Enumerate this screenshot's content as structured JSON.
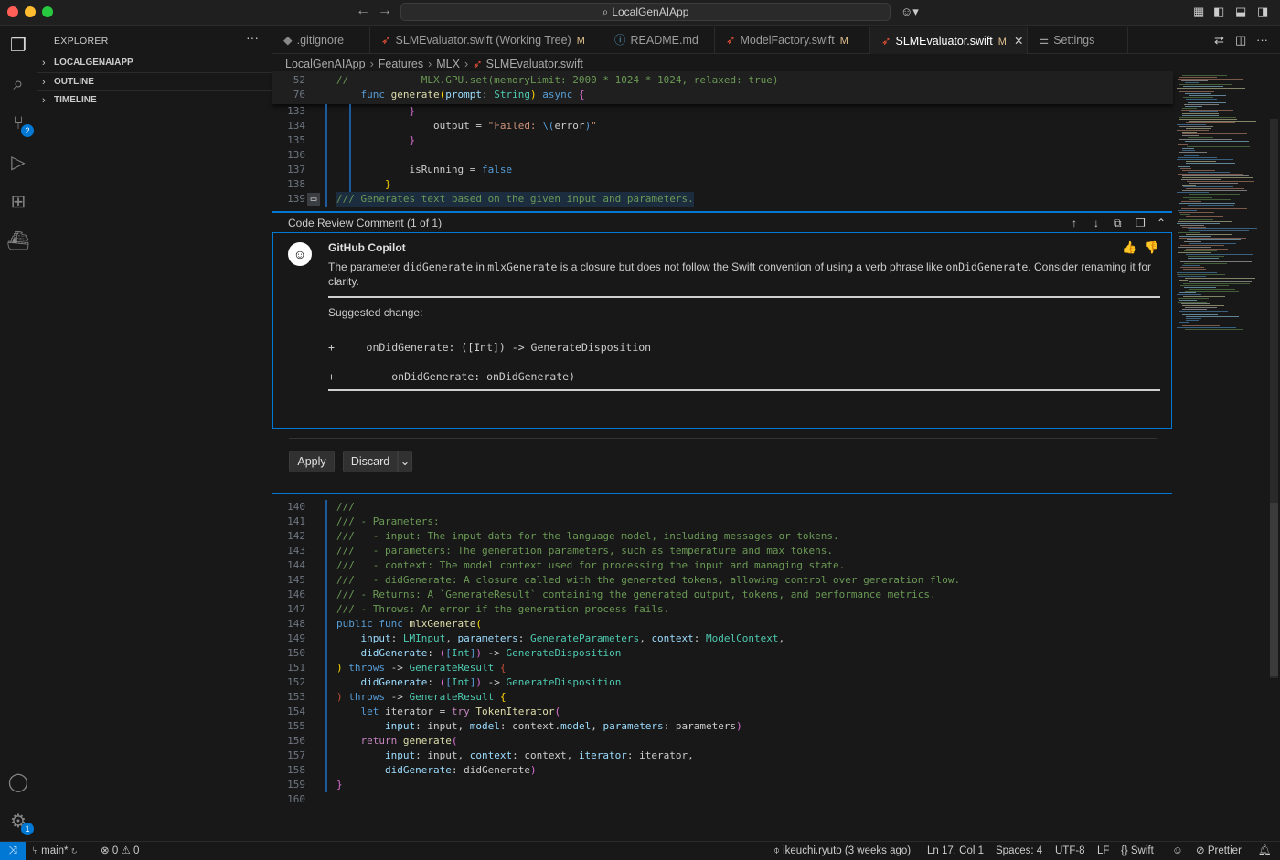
{
  "window": {
    "title": "LocalGenAIApp"
  },
  "activity": {
    "scm_badge": "2",
    "settings_badge": "1"
  },
  "sidebar": {
    "title": "EXPLORER",
    "sections": [
      "LOCALGENAIAPP",
      "OUTLINE",
      "TIMELINE"
    ]
  },
  "tabs": [
    {
      "label": ".gitignore",
      "modified": ""
    },
    {
      "label": "SLMEvaluator.swift (Working Tree)",
      "modified": "M"
    },
    {
      "label": "README.md",
      "modified": ""
    },
    {
      "label": "ModelFactory.swift",
      "modified": "M"
    },
    {
      "label": "SLMEvaluator.swift",
      "modified": "M"
    },
    {
      "label": "Settings",
      "modified": ""
    }
  ],
  "breadcrumb": [
    "LocalGenAIApp",
    "Features",
    "MLX",
    "SLMEvaluator.swift"
  ],
  "sticky": [
    {
      "num": "52",
      "code": "//            MLX.GPU.set(memoryLimit: 2000 * 1024 * 1024, relaxed: true)"
    },
    {
      "num": "76",
      "code": "    func generate(prompt: String) async {"
    }
  ],
  "code_top": [
    {
      "num": "133",
      "code": "            }"
    },
    {
      "num": "134",
      "code": "                output = \"Failed: \\(error)\""
    },
    {
      "num": "135",
      "code": "            }"
    },
    {
      "num": "136",
      "code": ""
    },
    {
      "num": "137",
      "code": "            isRunning = false"
    },
    {
      "num": "138",
      "code": "        }"
    },
    {
      "num": "139",
      "code": "/// Generates text based on the given input and parameters."
    }
  ],
  "review": {
    "header": "Code Review Comment (1 of 1)",
    "author": "GitHub Copilot",
    "comment_pre": "The parameter ",
    "comment_code1": "didGenerate",
    "comment_mid1": " in ",
    "comment_code2": "mlxGenerate",
    "comment_mid2": " is a closure but does not follow the Swift convention of using a verb phrase like ",
    "comment_code3": "onDidGenerate",
    "comment_post": ". Consider renaming it for clarity.",
    "suggested_label": "Suggested change:",
    "diff": [
      "+     onDidGenerate: ([Int]) -> GenerateDisposition",
      "+         onDidGenerate: onDidGenerate)"
    ],
    "apply": "Apply",
    "discard": "Discard"
  },
  "code_bottom": [
    {
      "num": "140",
      "code": "///"
    },
    {
      "num": "141",
      "code": "/// - Parameters:"
    },
    {
      "num": "142",
      "code": "///   - input: The input data for the language model, including messages or tokens."
    },
    {
      "num": "143",
      "code": "///   - parameters: The generation parameters, such as temperature and max tokens."
    },
    {
      "num": "144",
      "code": "///   - context: The model context used for processing the input and managing state."
    },
    {
      "num": "145",
      "code": "///   - didGenerate: A closure called with the generated tokens, allowing control over generation flow."
    },
    {
      "num": "146",
      "code": "/// - Returns: A `GenerateResult` containing the generated output, tokens, and performance metrics."
    },
    {
      "num": "147",
      "code": "/// - Throws: An error if the generation process fails."
    },
    {
      "num": "148",
      "code": "public func mlxGenerate("
    },
    {
      "num": "149",
      "code": "    input: LMInput, parameters: GenerateParameters, context: ModelContext,"
    },
    {
      "num": "150",
      "code": "    didGenerate: ([Int]) -> GenerateDisposition"
    },
    {
      "num": "151",
      "code": ") throws -> GenerateResult {"
    },
    {
      "num": "152",
      "code": "    didGenerate: ([Int]) -> GenerateDisposition"
    },
    {
      "num": "153",
      "code": ") throws -> GenerateResult {"
    },
    {
      "num": "154",
      "code": "    let iterator = try TokenIterator("
    },
    {
      "num": "155",
      "code": "        input: input, model: context.model, parameters: parameters)"
    },
    {
      "num": "156",
      "code": "    return generate("
    },
    {
      "num": "157",
      "code": "        input: input, context: context, iterator: iterator,"
    },
    {
      "num": "158",
      "code": "        didGenerate: didGenerate)"
    },
    {
      "num": "159",
      "code": "}"
    },
    {
      "num": "160",
      "code": ""
    }
  ],
  "status": {
    "branch": "main*",
    "errors": "0",
    "warnings": "0",
    "blame": "ikeuchi.ryuto (3 weeks ago)",
    "position": "Ln 17, Col 1",
    "spaces": "Spaces: 4",
    "encoding": "UTF-8",
    "eol": "LF",
    "language": "Swift",
    "prettier": "Prettier"
  },
  "colors": {
    "accent": "#0078d4",
    "background": "#1f1f1f",
    "comment": "#6a9955"
  }
}
